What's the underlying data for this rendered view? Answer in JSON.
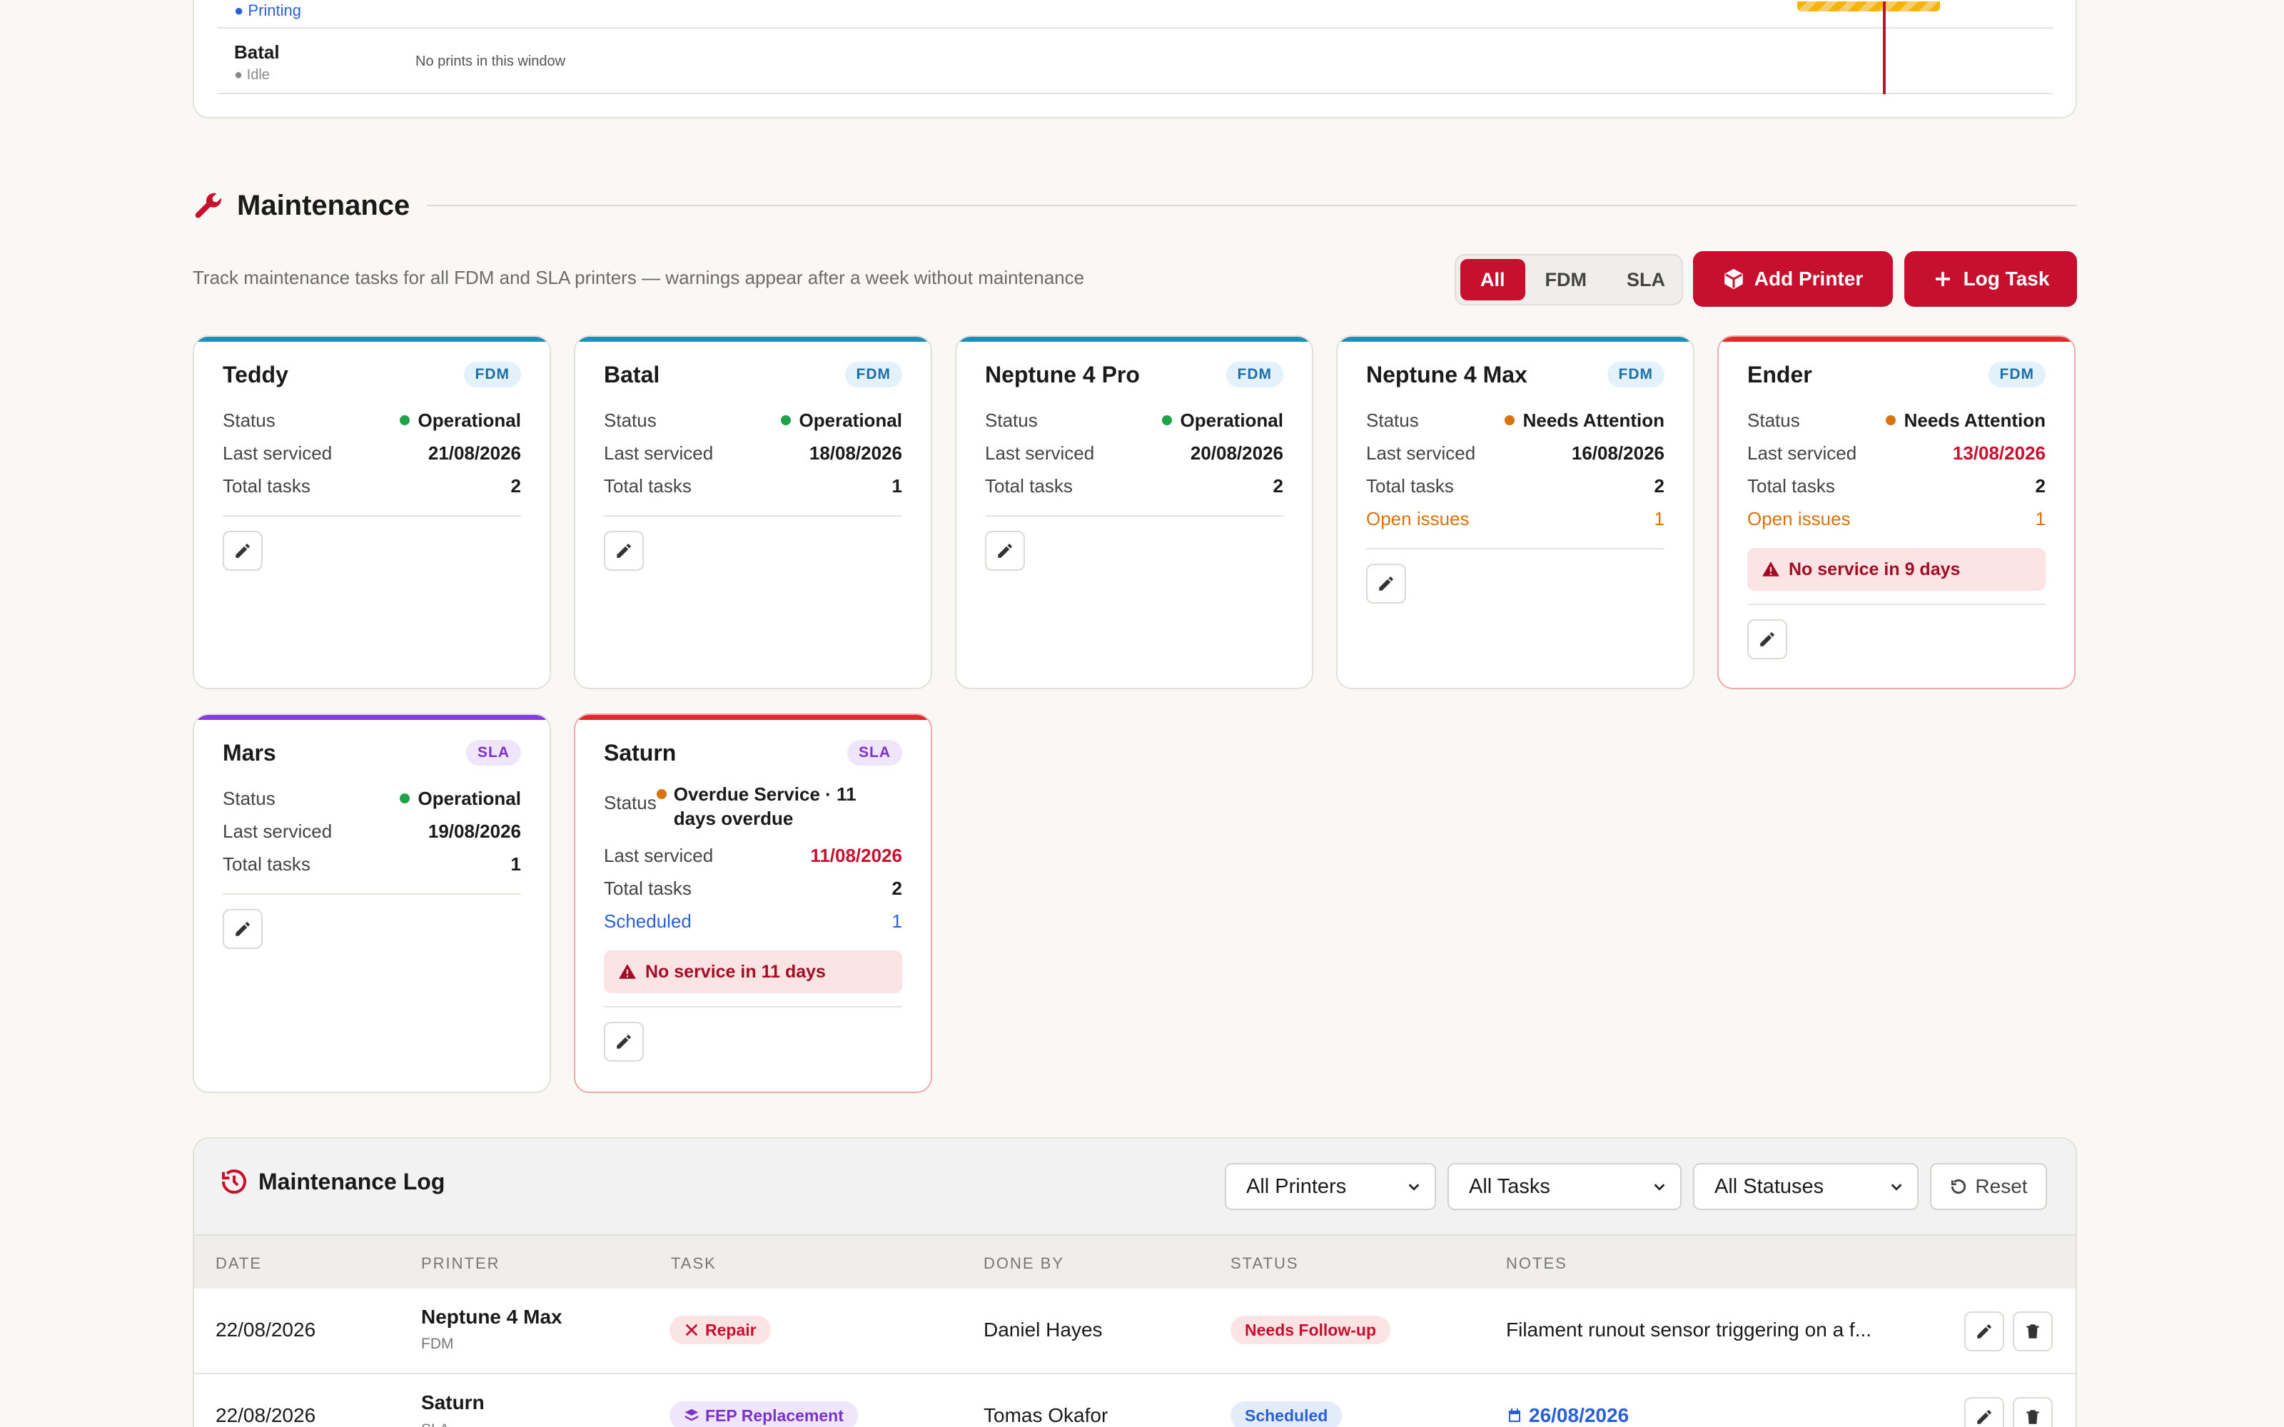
{
  "schedule": {
    "printing_status": "● Printing",
    "batal_name": "Batal",
    "batal_status": "● Idle",
    "no_prints": "No prints in this window"
  },
  "maintenance": {
    "title": "Maintenance",
    "subtitle": "Track maintenance tasks for all FDM and SLA printers — warnings appear after a week without maintenance",
    "filters": [
      "All",
      "FDM",
      "SLA"
    ],
    "active_filter": "All",
    "add_printer_label": "Add Printer",
    "log_task_label": "Log Task",
    "colors": {
      "accent": "#c8102e",
      "fdm": "#1d8fb8",
      "sla": "#8a3be0",
      "warn": "#e02a2a",
      "ok": "#1ea34a",
      "attention": "#d9730d"
    }
  },
  "labels": {
    "status": "Status",
    "last_serviced": "Last serviced",
    "total_tasks": "Total tasks",
    "open_issues": "Open issues",
    "scheduled": "Scheduled"
  },
  "cards": [
    {
      "name": "Teddy",
      "type": "FDM",
      "status": "Operational",
      "last_serviced": "21/08/2026",
      "total_tasks": "2"
    },
    {
      "name": "Batal",
      "type": "FDM",
      "status": "Operational",
      "last_serviced": "18/08/2026",
      "total_tasks": "1"
    },
    {
      "name": "Neptune 4 Pro",
      "type": "FDM",
      "status": "Operational",
      "last_serviced": "20/08/2026",
      "total_tasks": "2"
    },
    {
      "name": "Neptune 4 Max",
      "type": "FDM",
      "status": "Needs Attention",
      "last_serviced": "16/08/2026",
      "total_tasks": "2",
      "open_issues": "1"
    },
    {
      "name": "Ender",
      "type": "FDM",
      "status": "Needs Attention",
      "last_serviced": "13/08/2026",
      "total_tasks": "2",
      "open_issues": "1",
      "alert": "No service in 9 days"
    },
    {
      "name": "Mars",
      "type": "SLA",
      "status": "Operational",
      "last_serviced": "19/08/2026",
      "total_tasks": "1"
    },
    {
      "name": "Saturn",
      "type": "SLA",
      "status": "Overdue Service · 11 days overdue",
      "last_serviced": "11/08/2026",
      "total_tasks": "2",
      "scheduled": "1",
      "alert": "No service in 11 days"
    }
  ],
  "log": {
    "title": "Maintenance Log",
    "filters": {
      "printers": "All Printers",
      "tasks": "All Tasks",
      "statuses": "All Statuses"
    },
    "reset_label": "Reset",
    "columns": [
      "DATE",
      "PRINTER",
      "TASK",
      "DONE BY",
      "STATUS",
      "NOTES"
    ],
    "rows": [
      {
        "date": "22/08/2026",
        "printer": "Neptune 4 Max",
        "printer_type": "FDM",
        "task": "Repair",
        "done_by": "Daniel Hayes",
        "status": "Needs Follow-up",
        "notes": "Filament runout sensor triggering on a f..."
      },
      {
        "date": "22/08/2026",
        "printer": "Saturn",
        "printer_type": "SLA",
        "task": "FEP Replacement",
        "done_by": "Tomas Okafor",
        "status": "Scheduled",
        "notes": "26/08/2026"
      }
    ]
  }
}
